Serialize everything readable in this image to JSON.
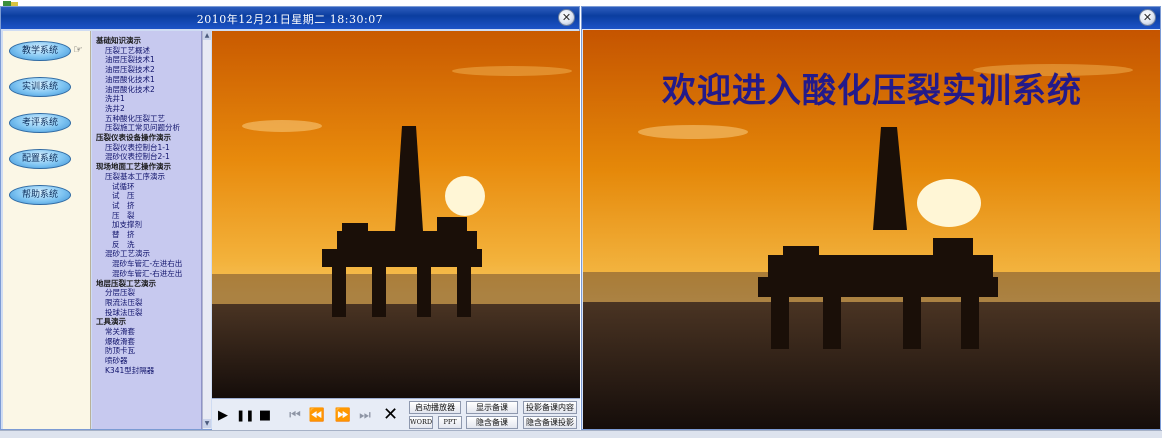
{
  "left_window": {
    "title": "2010年12月21日星期二 18:30:07",
    "close_label": "✕"
  },
  "right_window": {
    "title": "",
    "close_label": "✕",
    "welcome": "欢迎进入酸化压裂实训系统"
  },
  "nav": {
    "items": [
      {
        "label": "教学系统"
      },
      {
        "label": "实训系统"
      },
      {
        "label": "考评系统"
      },
      {
        "label": "配置系统"
      },
      {
        "label": "帮助系统"
      }
    ],
    "pointer_icon": "pointing-hand-icon"
  },
  "tree": {
    "lines": [
      {
        "text": "基础知识演示",
        "level": 0,
        "cat": true
      },
      {
        "text": "压裂工艺概述",
        "level": 1
      },
      {
        "text": "油层压裂技术1",
        "level": 1
      },
      {
        "text": "油层压裂技术2",
        "level": 1
      },
      {
        "text": "油层酸化技术1",
        "level": 1
      },
      {
        "text": "油层酸化技术2",
        "level": 1
      },
      {
        "text": "洗井1",
        "level": 1
      },
      {
        "text": "洗井2",
        "level": 1
      },
      {
        "text": "五种酸化压裂工艺",
        "level": 1
      },
      {
        "text": "压裂施工常见问题分析",
        "level": 1
      },
      {
        "text": "压裂仪表设备操作演示",
        "level": 0,
        "cat": true
      },
      {
        "text": "压裂仪表控制台1-1",
        "level": 1
      },
      {
        "text": "混砂仪表控制台2-1",
        "level": 1
      },
      {
        "text": "现场地面工艺操作演示",
        "level": 0,
        "cat": true
      },
      {
        "text": "压裂基本工序演示",
        "level": 1
      },
      {
        "text": "试循环",
        "level": 2
      },
      {
        "text": "试　压",
        "level": 2
      },
      {
        "text": "试　挤",
        "level": 2
      },
      {
        "text": "压　裂",
        "level": 2
      },
      {
        "text": "加支撑剂",
        "level": 2
      },
      {
        "text": "替　挤",
        "level": 2
      },
      {
        "text": "反　洗",
        "level": 2
      },
      {
        "text": "混砂工艺演示",
        "level": 1
      },
      {
        "text": "混砂车管汇-左进右出",
        "level": 2
      },
      {
        "text": "混砂车管汇-右进左出",
        "level": 2
      },
      {
        "text": "地层压裂工艺演示",
        "level": 0,
        "cat": true
      },
      {
        "text": "分层压裂",
        "level": 1
      },
      {
        "text": "限流法压裂",
        "level": 1
      },
      {
        "text": "投球法压裂",
        "level": 1
      },
      {
        "text": "工具演示",
        "level": 0,
        "cat": true
      },
      {
        "text": "常关滑套",
        "level": 1
      },
      {
        "text": "爆破滑套",
        "level": 1
      },
      {
        "text": "防顶卡瓦",
        "level": 1
      },
      {
        "text": "喷砂器",
        "level": 1
      },
      {
        "text": "K341型封隔器",
        "level": 1
      }
    ]
  },
  "controls": {
    "play": "▶",
    "pause": "❚❚",
    "stop": "■",
    "prev_end": "⏮",
    "rewind": "⏪",
    "forward": "⏩",
    "next_end": "⏭",
    "close_x": "✕",
    "buttons": {
      "start_player": "启动播放器",
      "show_notes": "显示备课",
      "projection_content": "投影备课内容",
      "word": "WORD",
      "ppt": "PPT",
      "hide_notes": "隐含备课",
      "hide_projection": "隐含备课投影"
    }
  },
  "colors": {
    "title_bar": "#0b3ea0",
    "tree_bg": "#c7c9ef",
    "nav_bg": "#fbf7e6",
    "welcome_text": "#241a8a",
    "sky_top": "#d46a00",
    "sun": "#fff6d6"
  }
}
